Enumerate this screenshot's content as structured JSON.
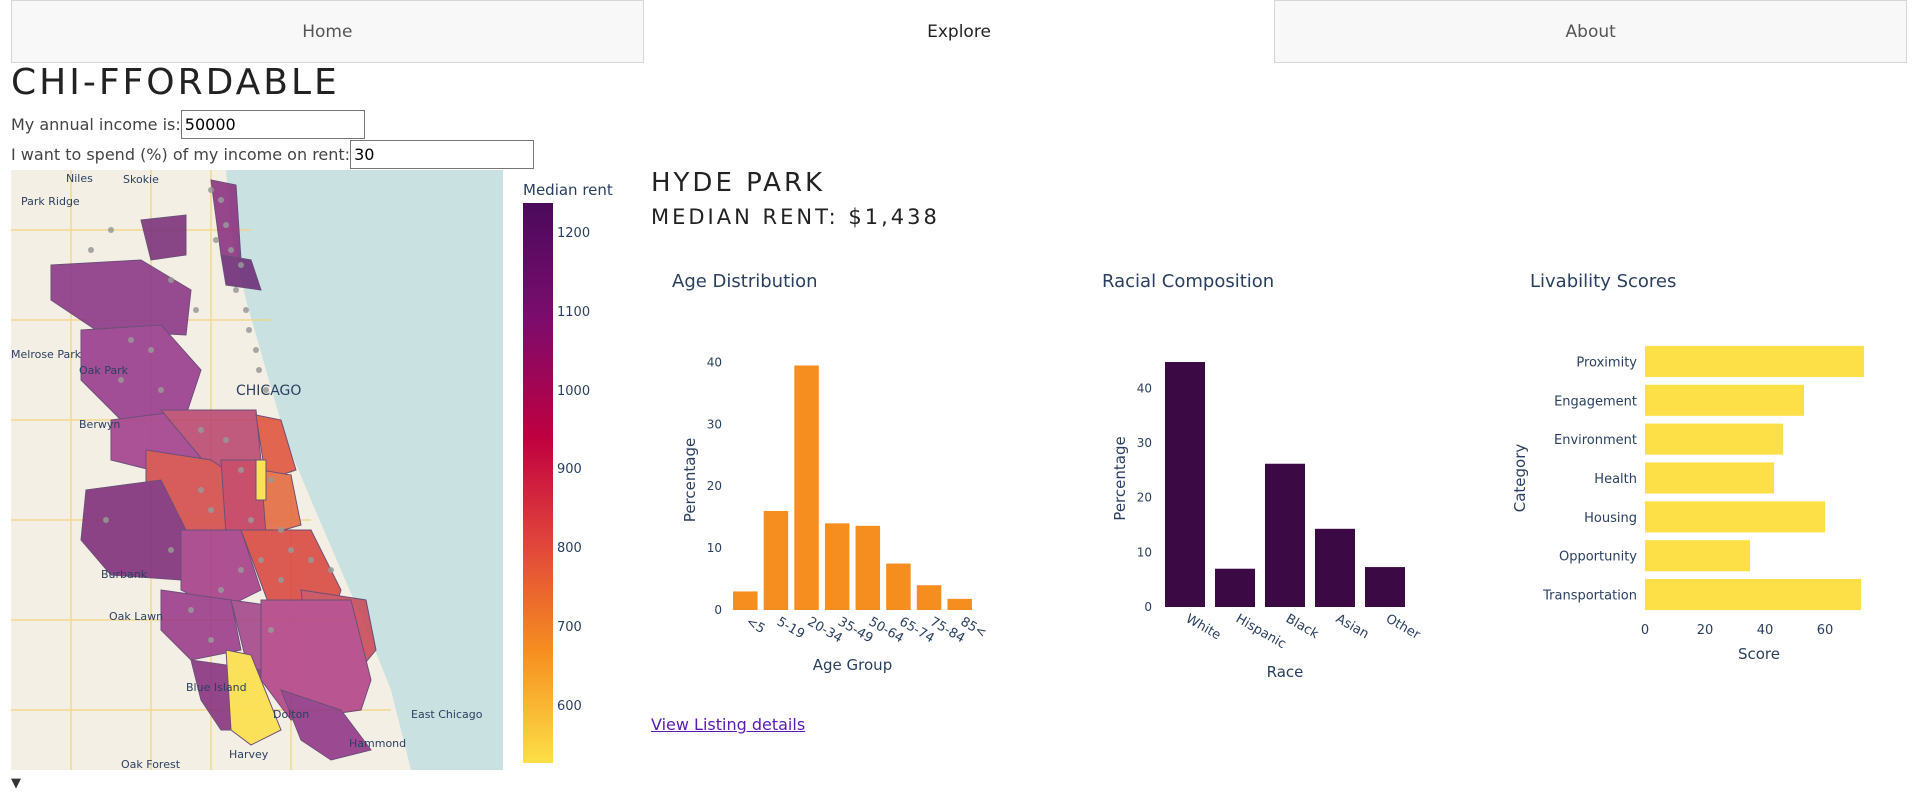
{
  "tabs": [
    {
      "label": "Home",
      "active": false
    },
    {
      "label": "Explore",
      "active": true
    },
    {
      "label": "About",
      "active": false
    }
  ],
  "app_title": "CHI-FFORDABLE",
  "inputs": {
    "income_label": "My annual income is:",
    "income_value": "50000",
    "percent_label": "I want to spend (%) of my income on rent:",
    "percent_value": "30"
  },
  "map": {
    "place_labels": [
      "Niles",
      "Skokie",
      "Park Ridge",
      "Melrose Park",
      "Oak Park",
      "CHICAGO",
      "Berwyn",
      "Burbank",
      "Oak Lawn",
      "Blue Island",
      "Dolton",
      "East Chicago",
      "Hammond",
      "Harvey",
      "Oak Forest"
    ],
    "colorbar": {
      "title": "Median rent",
      "ticks": [
        "1200",
        "1100",
        "1000",
        "900",
        "800",
        "700",
        "600"
      ],
      "colors": [
        "#fde047",
        "#f68e1f",
        "#e0423c",
        "#c0003f",
        "#7a0c6e",
        "#4a0a5c"
      ]
    }
  },
  "neighborhood": {
    "name": "HYDE PARK",
    "median_rent": "MEDIAN RENT: $1,438"
  },
  "link_text": "View Listing details",
  "toggle": "▼",
  "chart_data": [
    {
      "type": "bar",
      "title": "Age Distribution",
      "xlabel": "Age Group",
      "ylabel": "Percentage",
      "categories": [
        "<5",
        "5-19",
        "20-34",
        "35-49",
        "50-64",
        "65-74",
        "75-84",
        "85<"
      ],
      "values": [
        3,
        16,
        39.5,
        14,
        13.6,
        7.5,
        4,
        1.8
      ],
      "ylim": [
        0,
        42
      ],
      "yticks": [
        0,
        10,
        20,
        30,
        40
      ],
      "color": "#f68e1f"
    },
    {
      "type": "bar",
      "title": "Racial Composition",
      "xlabel": "Race",
      "ylabel": "Percentage",
      "categories": [
        "White",
        "Hispanic",
        "Black",
        "Asian",
        "Other"
      ],
      "values": [
        44.8,
        7,
        26.2,
        14.3,
        7.3
      ],
      "ylim": [
        0,
        47
      ],
      "yticks": [
        0,
        10,
        20,
        30,
        40
      ],
      "color": "#3b0a45"
    },
    {
      "type": "bar",
      "orientation": "horizontal",
      "title": "Livability Scores",
      "xlabel": "Score",
      "ylabel": "Category",
      "categories": [
        "Proximity",
        "Engagement",
        "Environment",
        "Health",
        "Housing",
        "Opportunity",
        "Transportation"
      ],
      "values": [
        73,
        53,
        46,
        43,
        60,
        35,
        72
      ],
      "xlim": [
        0,
        80
      ],
      "xticks": [
        0,
        20,
        40,
        60
      ],
      "color": "#fde047"
    }
  ]
}
